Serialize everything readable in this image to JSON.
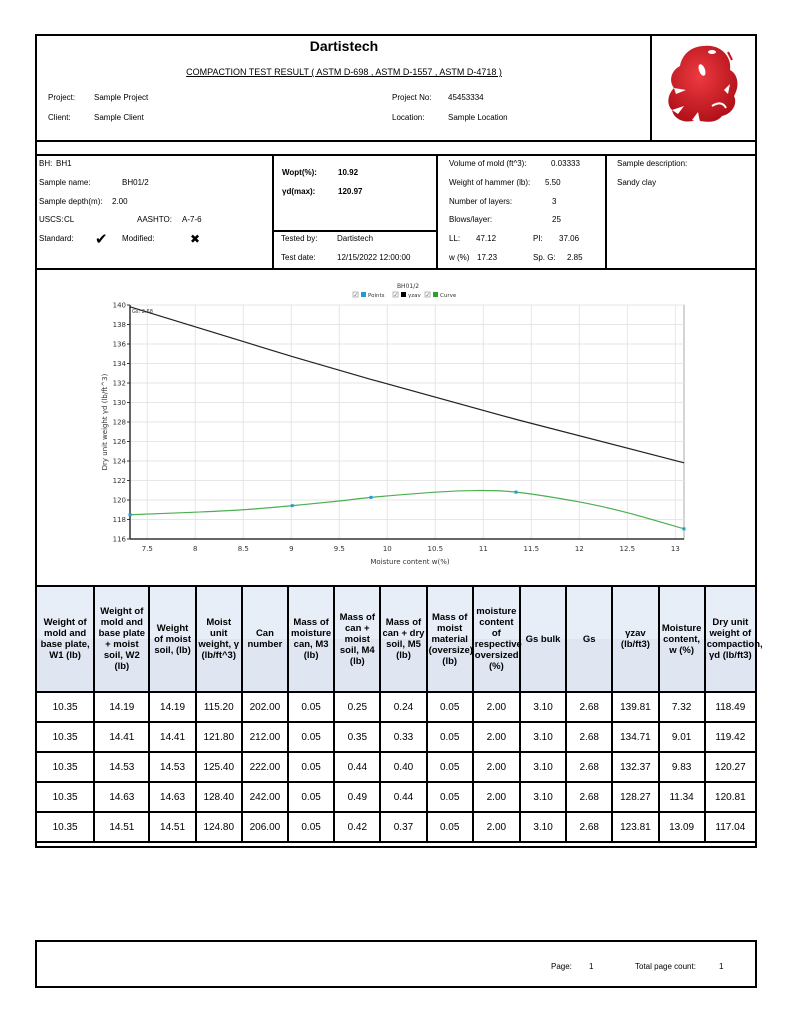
{
  "header": {
    "company": "Dartistech",
    "report_title": "COMPACTION TEST RESULT ( ASTM D-698 , ASTM D-1557 , ASTM D-4718 )",
    "project_label": "Project:",
    "project": "Sample Project",
    "client_label": "Client:",
    "client": "Sample Client",
    "project_no_label": "Project No:",
    "project_no": "45453334",
    "location_label": "Location:",
    "location": "Sample Location"
  },
  "sample": {
    "bh_label": "BH:",
    "bh": "BH1",
    "name_label": "Sample name:",
    "name": "BH01/2",
    "depth_label": "Sample depth(m):",
    "depth": "2.00",
    "uscs_label": "USCS:",
    "uscs": "CL",
    "aashto_label": "AASHTO:",
    "aashto": "A-7-6",
    "standard_label": "Standard:",
    "modified_label": "Modified:",
    "standard_checked": true,
    "modified_checked": false
  },
  "results": {
    "wopt_label": "Wopt(%):",
    "wopt": "10.92",
    "gd_label": "γd(max):",
    "gd": "120.97",
    "tested_by_label": "Tested by:",
    "tested_by": "Dartistech",
    "test_date_label": "Test date:",
    "test_date": "12/15/2022 12:00:00"
  },
  "mold": {
    "volume_label": "Volume of mold (ft^3):",
    "volume": "0.03333",
    "hammer_label": "Weight of hammer (lb):",
    "hammer": "5.50",
    "layers_label": "Number of layers:",
    "layers": "3",
    "blows_label": "Blows/layer:",
    "blows": "25",
    "ll_label": "LL:",
    "ll": "47.12",
    "pi_label": "PI:",
    "pi": "37.06",
    "w_label": "w (%)",
    "w": "17.23",
    "spg_label": "Sp. G:",
    "spg": "2.85"
  },
  "description": {
    "label": "Sample description:",
    "value": "Sandy clay"
  },
  "chart_data": {
    "type": "line",
    "title": "BH01/2",
    "xlabel": "Moisture content w(%)",
    "ylabel": "Dry unit weight γd (lb/ft^3)",
    "xlim": [
      7.32,
      13.09
    ],
    "ylim": [
      116,
      140
    ],
    "xticks": [
      7.5,
      8,
      8.5,
      9,
      9.5,
      10,
      10.5,
      11,
      11.5,
      12,
      12.5,
      13
    ],
    "yticks": [
      116,
      118,
      120,
      122,
      124,
      126,
      128,
      130,
      132,
      134,
      136,
      138,
      140
    ],
    "grid": true,
    "legend": [
      {
        "name": "Points",
        "color": "#1f9bd8",
        "checked": true
      },
      {
        "name": "γzav",
        "color": "#000000",
        "checked": true
      },
      {
        "name": "Curve",
        "color": "#2ca02c",
        "checked": true
      }
    ],
    "legend_position": "top-center",
    "annotation": "Gs: 2.68",
    "series": [
      {
        "name": "Points",
        "x": [
          7.32,
          9.01,
          9.83,
          11.34,
          13.09
        ],
        "y": [
          118.49,
          119.42,
          120.27,
          120.81,
          117.04
        ]
      },
      {
        "name": "γzav",
        "x": [
          7.32,
          9.01,
          9.83,
          11.34,
          13.09
        ],
        "y": [
          139.81,
          134.71,
          132.37,
          128.27,
          123.81
        ]
      },
      {
        "name": "Curve",
        "x": [
          7.32,
          8.0,
          8.5,
          9.01,
          9.5,
          9.83,
          10.5,
          10.92,
          11.34,
          12.0,
          12.5,
          13.09
        ],
        "y": [
          118.49,
          118.75,
          119.0,
          119.42,
          119.9,
          120.27,
          120.8,
          120.97,
          120.81,
          119.8,
          118.7,
          117.04
        ]
      }
    ]
  },
  "table": {
    "headers": [
      "Weight of mold and base plate, W1 (lb)",
      "Weight of mold and base plate + moist soil, W2 (lb)",
      "Weight of moist soil, (lb)",
      "Moist unit weight, γ (lb/ft^3)",
      "Can number",
      "Mass of moisture can, M3 (lb)",
      "Mass of can + moist soil, M4 (lb)",
      "Mass of can + dry soil, M5 (lb)",
      "Mass of moist material (oversize) (lb)",
      "moisture content of respective oversized (%)",
      "Gs bulk",
      "Gs",
      "γzav (lb/ft3)",
      "Moisture content, w (%)",
      "Dry unit weight of compaction, γd (lb/ft3)"
    ],
    "rows": [
      [
        "10.35",
        "14.19",
        "14.19",
        "115.20",
        "202.00",
        "0.05",
        "0.25",
        "0.24",
        "0.05",
        "2.00",
        "3.10",
        "2.68",
        "139.81",
        "7.32",
        "118.49"
      ],
      [
        "10.35",
        "14.41",
        "14.41",
        "121.80",
        "212.00",
        "0.05",
        "0.35",
        "0.33",
        "0.05",
        "2.00",
        "3.10",
        "2.68",
        "134.71",
        "9.01",
        "119.42"
      ],
      [
        "10.35",
        "14.53",
        "14.53",
        "125.40",
        "222.00",
        "0.05",
        "0.44",
        "0.40",
        "0.05",
        "2.00",
        "3.10",
        "2.68",
        "132.37",
        "9.83",
        "120.27"
      ],
      [
        "10.35",
        "14.63",
        "14.63",
        "128.40",
        "242.00",
        "0.05",
        "0.49",
        "0.44",
        "0.05",
        "2.00",
        "3.10",
        "2.68",
        "128.27",
        "11.34",
        "120.81"
      ],
      [
        "10.35",
        "14.51",
        "14.51",
        "124.80",
        "206.00",
        "0.05",
        "0.42",
        "0.37",
        "0.05",
        "2.00",
        "3.10",
        "2.68",
        "123.81",
        "13.09",
        "117.04"
      ]
    ]
  },
  "footer": {
    "page_label": "Page:",
    "page": "1",
    "total_label": "Total page count:",
    "total": "1"
  },
  "colors": {
    "logo_red": "#d0202a",
    "curve_green": "#2ca02c",
    "points_blue": "#1f9bd8",
    "header_bg": "#e6ecf7"
  }
}
